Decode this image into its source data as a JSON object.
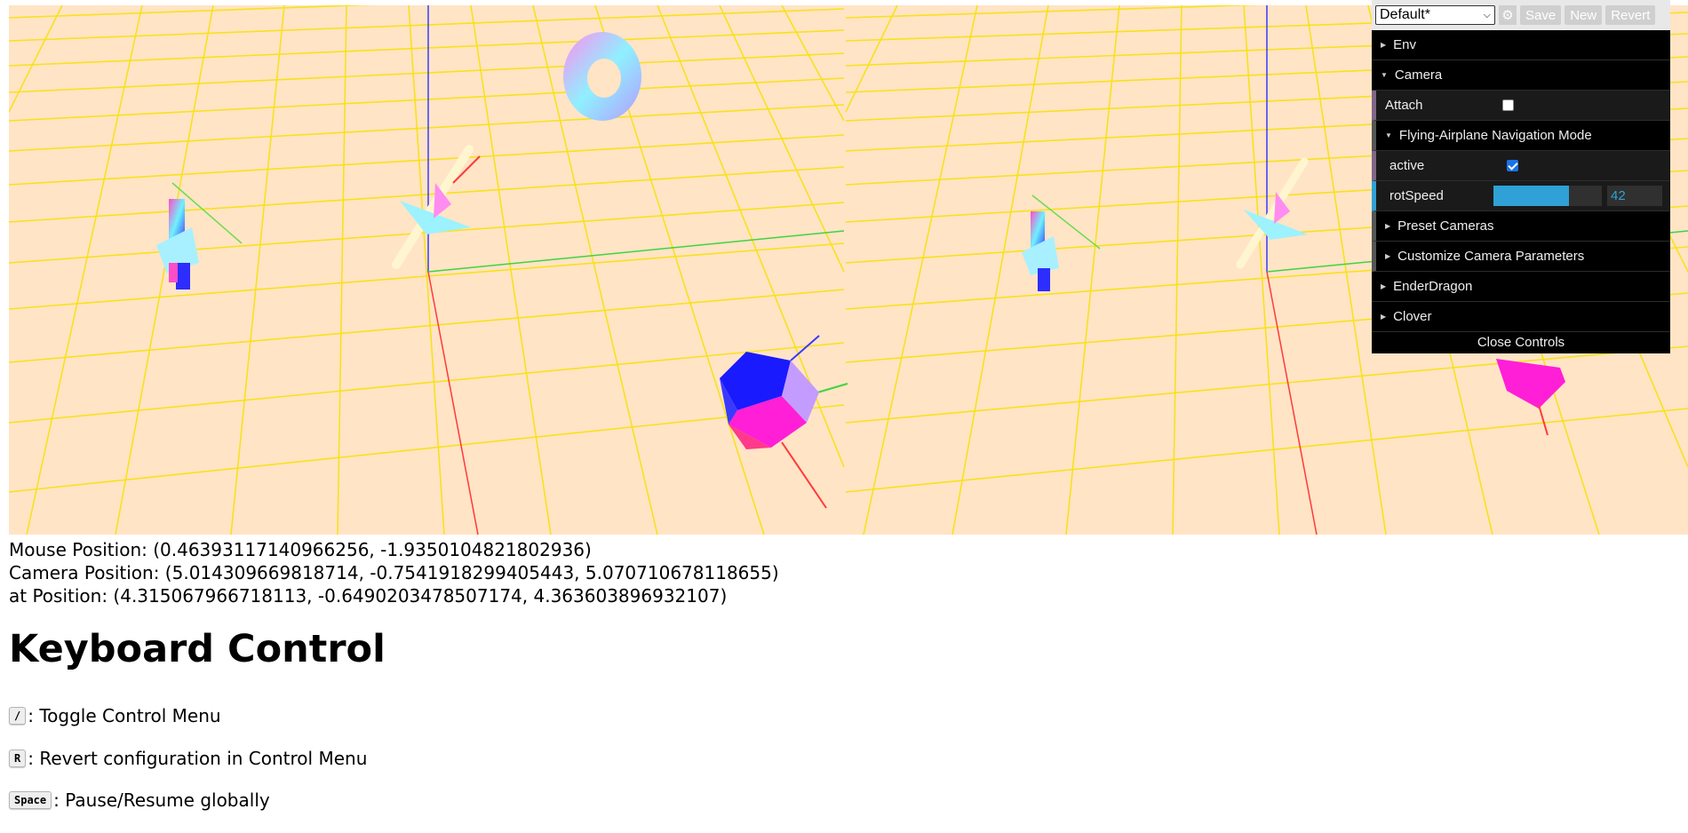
{
  "gui": {
    "preset_selected": "Default*",
    "save_label": "Save",
    "new_label": "New",
    "revert_label": "Revert",
    "folders": {
      "env": "Env",
      "camera": "Camera",
      "attach_label": "Attach",
      "attach_checked": false,
      "flying": "Flying-Airplane Navigation Mode",
      "active_label": "active",
      "active_checked": true,
      "rotspeed_label": "rotSpeed",
      "rotspeed_value": "42",
      "rotspeed_fraction": 0.7,
      "preset_cameras": "Preset Cameras",
      "customize": "Customize Camera Parameters",
      "enderdragon": "EnderDragon",
      "clover": "Clover"
    },
    "close_label": "Close Controls",
    "colors": {
      "slider": "#2fa1d6",
      "panel": "#000000"
    }
  },
  "status": {
    "mouse": "Mouse Position: (0.46393117140966256, -1.9350104821802936)",
    "camera": "Camera Position: (5.014309669818714, -0.7541918299405443, 5.070710678118655)",
    "at": "at Position: (4.315067966718113, -0.6490203478507174, 4.363603896932107)"
  },
  "keyboard": {
    "title": "Keyboard Control",
    "items": [
      {
        "key": "/",
        "desc": ": Toggle Control Menu"
      },
      {
        "key": "R",
        "desc": ": Revert configuration in Control Menu"
      },
      {
        "key": "Space",
        "desc": ": Pause/Resume globally"
      }
    ]
  },
  "scene": {
    "background": "#ffe4c6",
    "grid": "#f7e21b"
  }
}
